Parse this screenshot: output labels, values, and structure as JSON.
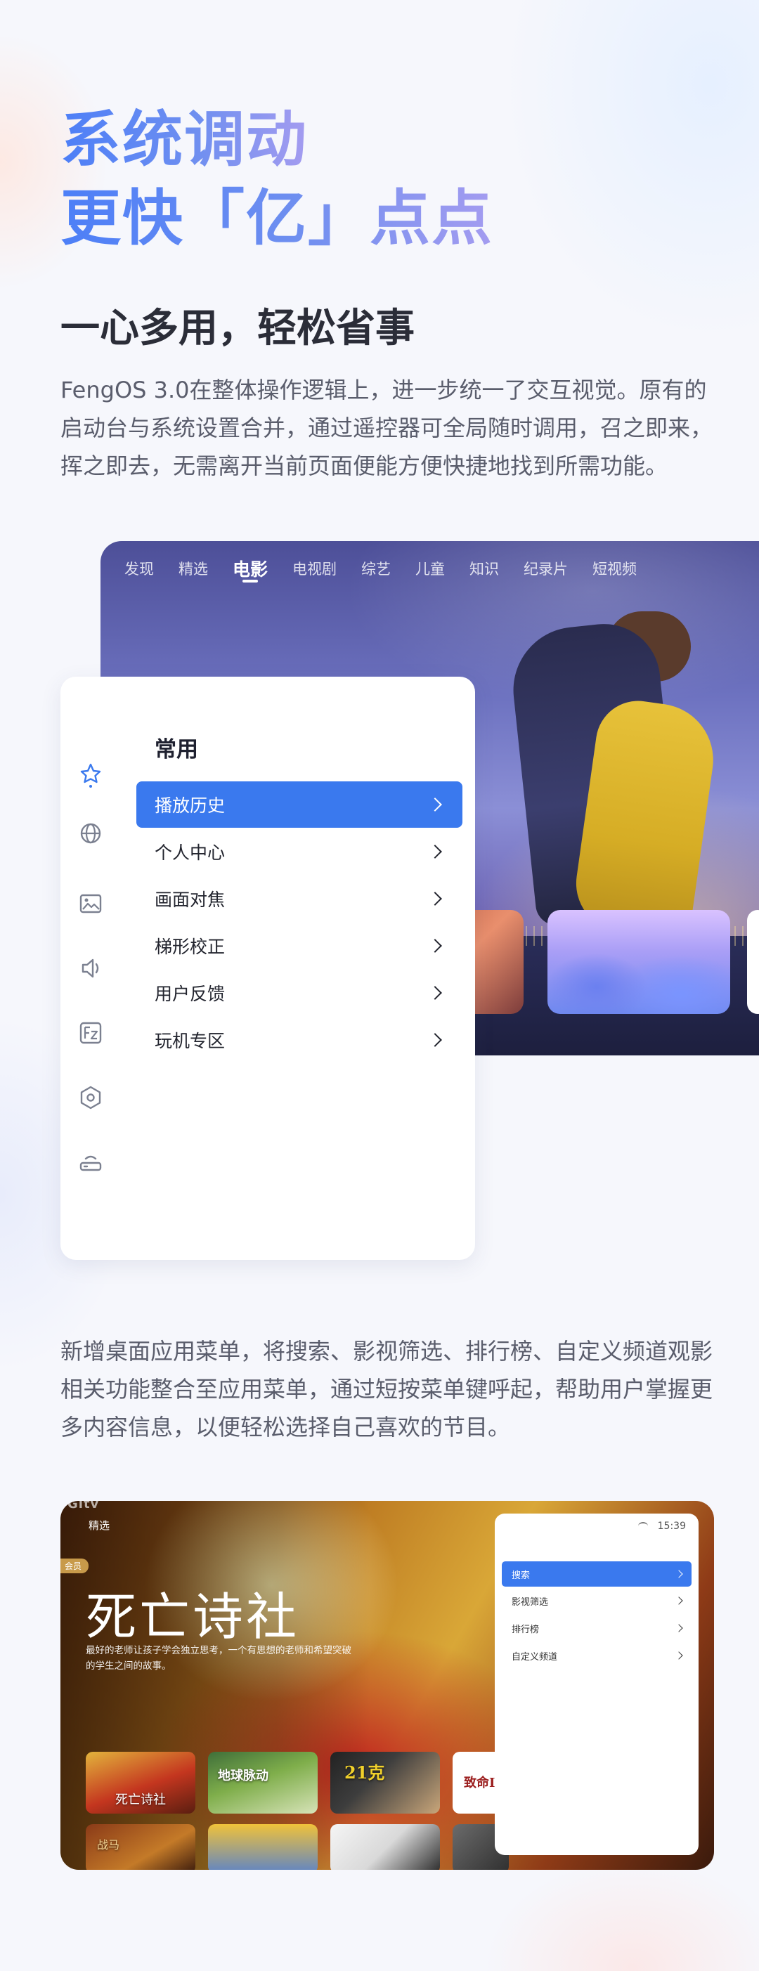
{
  "headline": {
    "line1": "系统调动",
    "line2": "更快「亿」点点"
  },
  "section1": {
    "title": "一心多用，轻松省事",
    "paragraph": "FengOS 3.0在整体操作逻辑上，进一步统一了交互视觉。原有的启动台与系统设置合并，通过遥控器可全局随时调用，召之即来，挥之即去，无需离开当前页面便能方便快捷地找到所需功能。"
  },
  "tv_home": {
    "tabs": [
      "发现",
      "精选",
      "电影",
      "电视剧",
      "综艺",
      "儿童",
      "知识",
      "纪录片",
      "短视频"
    ],
    "active_tab": "电影"
  },
  "settings_menu": {
    "heading": "常用",
    "items": [
      "播放历史",
      "个人中心",
      "画面对焦",
      "梯形校正",
      "用户反馈",
      "玩机专区"
    ],
    "selected": "播放历史",
    "side_icons": [
      "star-icon",
      "globe-icon",
      "image-icon",
      "speaker-icon",
      "fz-icon",
      "hexagon-settings-icon",
      "router-icon"
    ]
  },
  "section2": {
    "paragraph": "新增桌面应用菜单，将搜索、影视筛选、排行榜、自定义频道观影相关功能整合至应用菜单，通过短按菜单键呼起，帮助用户掌握更多内容信息，以便轻松选择自己喜欢的节目。"
  },
  "tv_app_menu": {
    "logo": "Gitv",
    "tab": "精选",
    "vip_badge": "会员",
    "movie_title": "死亡诗社",
    "movie_desc": "最好的老师让孩子学会独立思考，一个有思想的老师和希望突破的学生之间的故事。",
    "posters": [
      "死亡诗社",
      "地球脉动",
      "21克",
      "致命I",
      "战马"
    ],
    "clock": "15:39",
    "menu_items": [
      "搜索",
      "影视筛选",
      "排行榜",
      "自定义频道"
    ],
    "selected": "搜索"
  },
  "colors": {
    "accent_blue": "#3a79ee",
    "headline_gradient_start": "#4d7ff7",
    "headline_gradient_end": "#a49cf0"
  }
}
